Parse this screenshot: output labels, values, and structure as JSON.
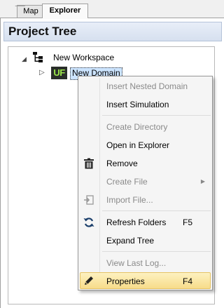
{
  "tabs": [
    {
      "label": "Map",
      "active": false
    },
    {
      "label": "Explorer",
      "active": true
    }
  ],
  "panel": {
    "title": "Project Tree"
  },
  "tree": {
    "workspace": {
      "label": "New Workspace",
      "expanded": true,
      "icon": "workspace-tree-icon"
    },
    "domain": {
      "label": "New Domain",
      "expanded": false,
      "icon_text": "UF",
      "selected": true
    }
  },
  "context_menu": {
    "items": [
      {
        "label": "Insert Nested Domain",
        "enabled": false
      },
      {
        "label": "Insert Simulation",
        "enabled": true
      },
      {
        "separator": true
      },
      {
        "label": "Create Directory",
        "enabled": false
      },
      {
        "label": "Open in Explorer",
        "enabled": true
      },
      {
        "label": "Remove",
        "enabled": true,
        "icon": "trash-icon"
      },
      {
        "label": "Create File",
        "enabled": false,
        "submenu": true
      },
      {
        "label": "Import File...",
        "enabled": false,
        "icon": "import-icon"
      },
      {
        "separator": true
      },
      {
        "label": "Refresh Folders",
        "shortcut": "F5",
        "enabled": true,
        "icon": "refresh-icon"
      },
      {
        "label": "Expand Tree",
        "enabled": true
      },
      {
        "separator": true
      },
      {
        "label": "View Last Log...",
        "enabled": false
      },
      {
        "label": "Properties",
        "shortcut": "F4",
        "enabled": true,
        "icon": "pencil-icon",
        "highlighted": true
      }
    ]
  },
  "colors": {
    "highlight": "#f7dc8a",
    "uf_icon_bg": "#2a2f2a",
    "uf_icon_fg": "#9de94a",
    "header_bg": "#d6e0ef"
  }
}
